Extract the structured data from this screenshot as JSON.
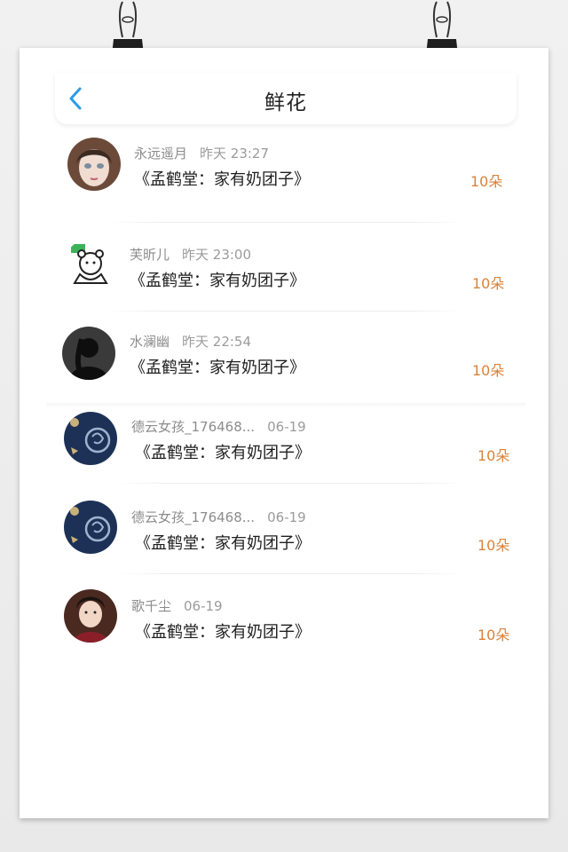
{
  "header": {
    "title": "鲜花"
  },
  "items": [
    {
      "name": "永远遥月",
      "time": "昨天 23:27",
      "book": "《孟鹤堂：家有奶团子》",
      "count": "10朵",
      "avatar": "girl-portrait"
    },
    {
      "name": "芙昕儿",
      "time": "昨天 23:00",
      "book": "《孟鹤堂：家有奶团子》",
      "count": "10朵",
      "avatar": "cartoon-bear"
    },
    {
      "name": "水澜幽",
      "time": "昨天 22:54",
      "book": "《孟鹤堂：家有奶团子》",
      "count": "10朵",
      "avatar": "dark-silhouette"
    },
    {
      "name": "德云女孩_176468...",
      "time": "06-19",
      "book": "《孟鹤堂：家有奶团子》",
      "count": "10朵",
      "avatar": "moon-emblem"
    },
    {
      "name": "德云女孩_176468...",
      "time": "06-19",
      "book": "《孟鹤堂：家有奶团子》",
      "count": "10朵",
      "avatar": "moon-emblem"
    },
    {
      "name": "歌千尘",
      "time": "06-19",
      "book": "《孟鹤堂：家有奶团子》",
      "count": "10朵",
      "avatar": "boy-portrait"
    }
  ],
  "colors": {
    "accent": "#2a9be8",
    "count": "#d9823a",
    "name": "#8c8c8c"
  }
}
